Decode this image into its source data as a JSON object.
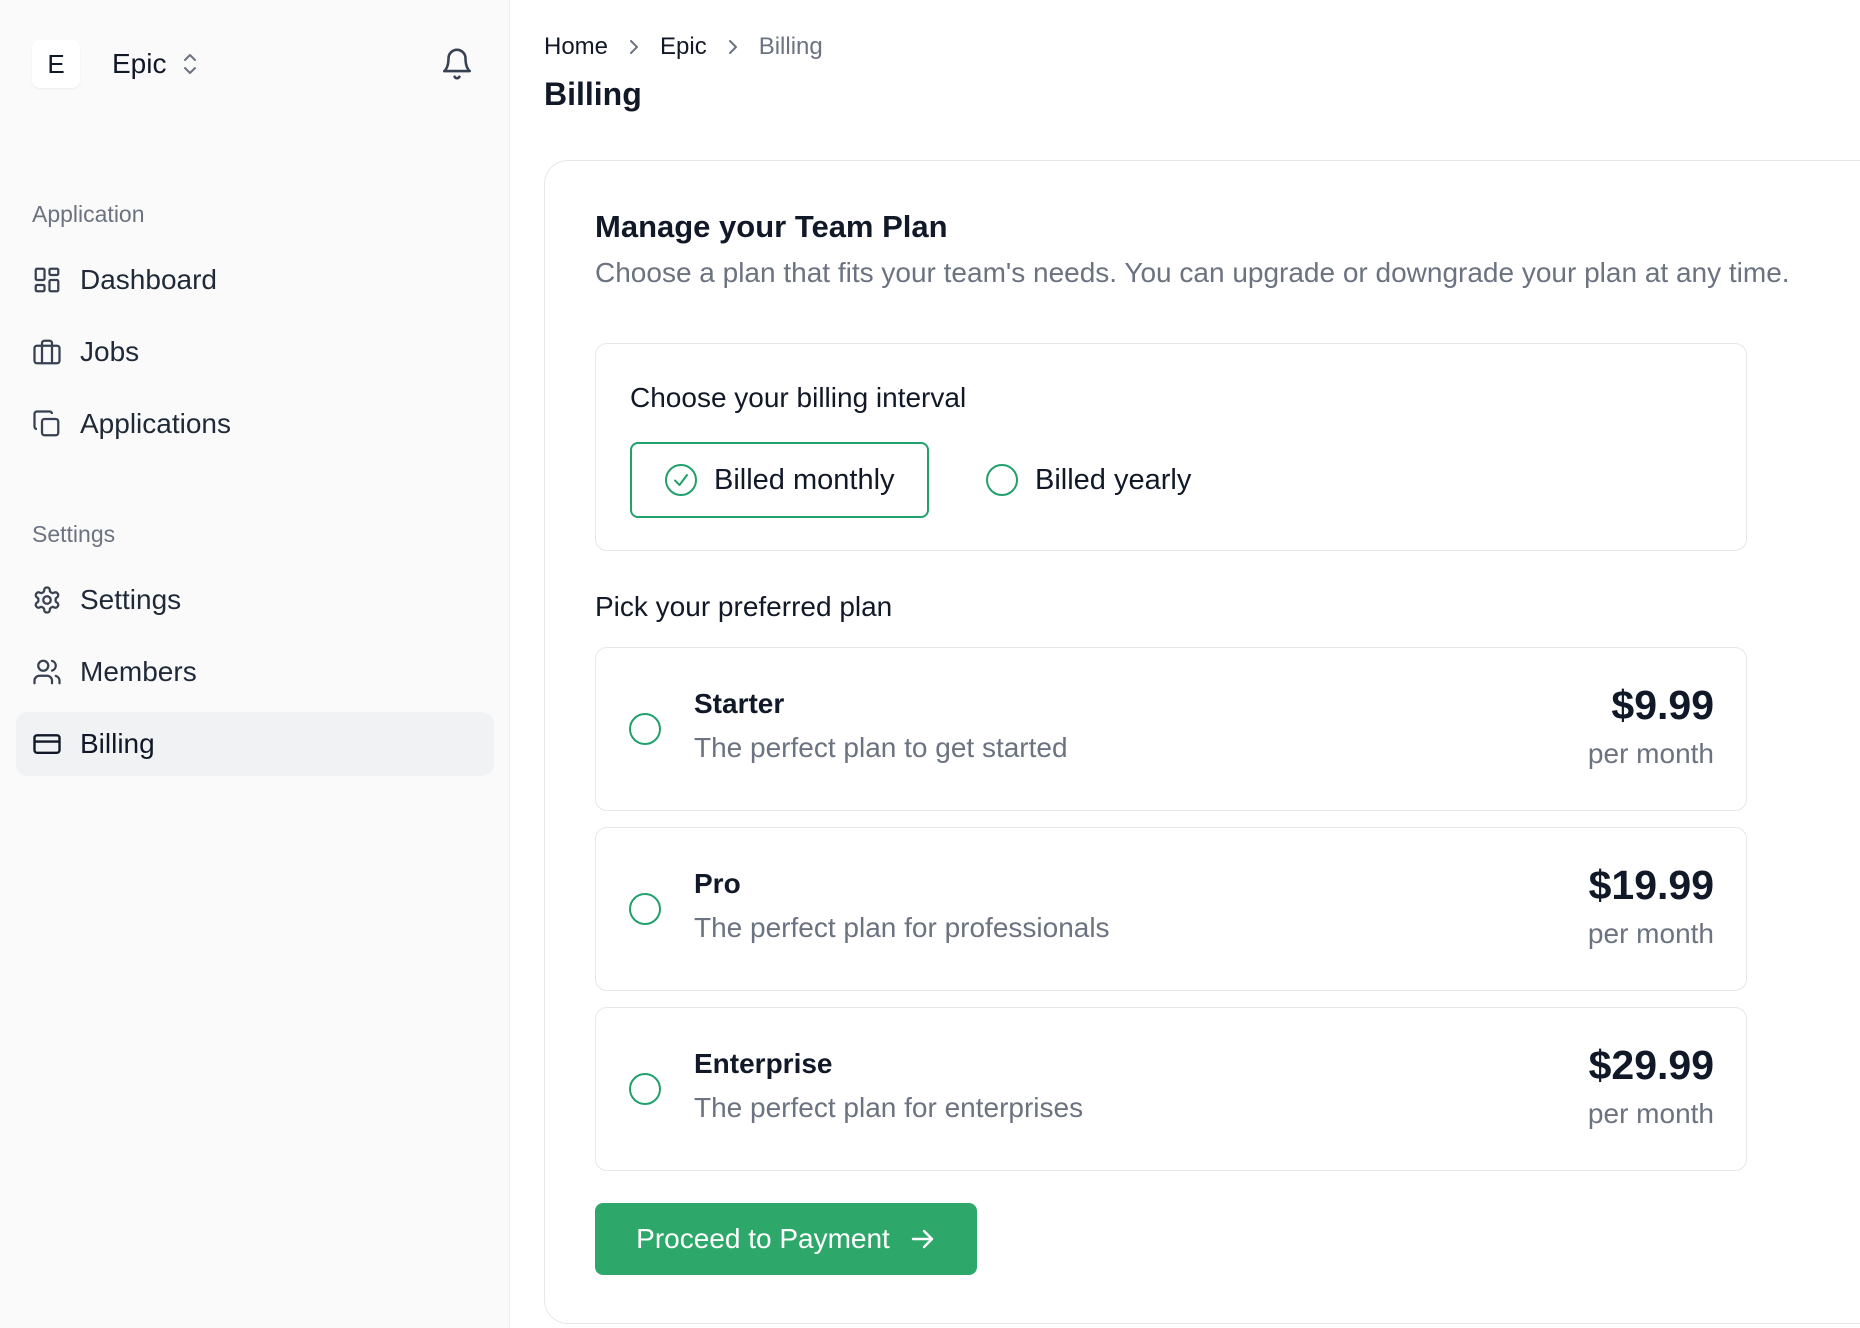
{
  "colors": {
    "accent": "#2ea86a",
    "accent_ring": "#22a06b",
    "muted_text": "#6b7280",
    "border": "#e5e7eb",
    "sidebar_bg": "#fafafa",
    "active_nav_bg": "#f1f2f4"
  },
  "sidebar": {
    "team": {
      "initial": "E",
      "name": "Epic",
      "icon": "chevron-up-down-icon"
    },
    "notifications_icon": "bell-icon",
    "sections": [
      {
        "label": "Application",
        "items": [
          {
            "label": "Dashboard",
            "icon": "dashboard-icon",
            "active": false
          },
          {
            "label": "Jobs",
            "icon": "briefcase-icon",
            "active": false
          },
          {
            "label": "Applications",
            "icon": "copy-icon",
            "active": false
          }
        ]
      },
      {
        "label": "Settings",
        "items": [
          {
            "label": "Settings",
            "icon": "gear-icon",
            "active": false
          },
          {
            "label": "Members",
            "icon": "users-icon",
            "active": false
          },
          {
            "label": "Billing",
            "icon": "credit-card-icon",
            "active": true
          }
        ]
      }
    ]
  },
  "header": {
    "breadcrumb": [
      "Home",
      "Epic",
      "Billing"
    ],
    "title": "Billing"
  },
  "main": {
    "card_title": "Manage your Team Plan",
    "card_description": "Choose a plan that fits your team's needs. You can upgrade or downgrade your plan at any time.",
    "interval": {
      "title": "Choose your billing interval",
      "options": [
        {
          "label": "Billed monthly",
          "selected": true
        },
        {
          "label": "Billed yearly",
          "selected": false
        }
      ]
    },
    "plans_heading": "Pick your preferred plan",
    "plans": [
      {
        "name": "Starter",
        "description": "The perfect plan to get started",
        "price": "$9.99",
        "period": "per month",
        "selected": false
      },
      {
        "name": "Pro",
        "description": "The perfect plan for professionals",
        "price": "$19.99",
        "period": "per month",
        "selected": false
      },
      {
        "name": "Enterprise",
        "description": "The perfect plan for enterprises",
        "price": "$29.99",
        "period": "per month",
        "selected": false
      }
    ],
    "proceed_label": "Proceed to Payment",
    "proceed_icon": "arrow-right-icon"
  }
}
